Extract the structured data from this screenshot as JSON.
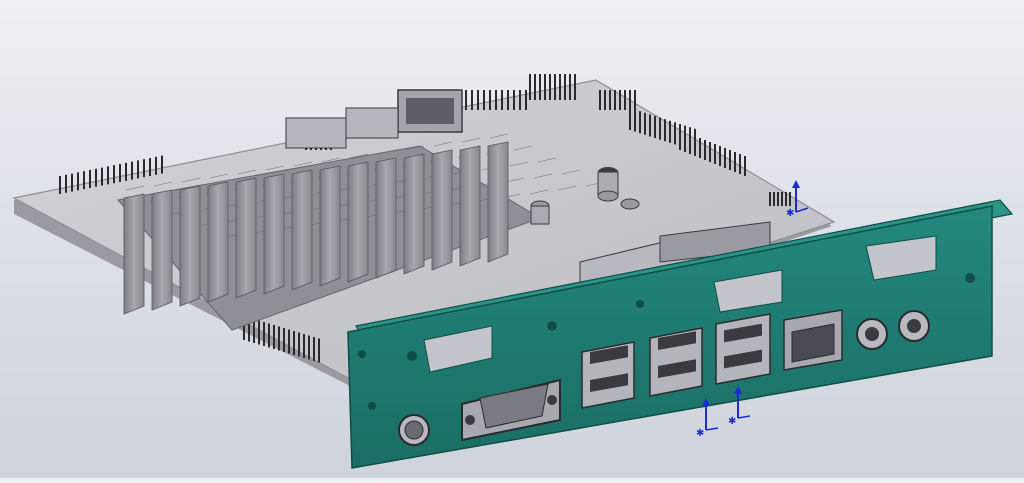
{
  "viewport": {
    "background_top": "#eef0f4",
    "background_bottom": "#cfd4dc"
  },
  "model": {
    "board_color": "#c9c9cf",
    "board_edge_color": "#8e8e96",
    "heatsink_color": "#9c9ca4",
    "bracket_color": "#1f7c72",
    "bracket_edge_color": "#0f4e47",
    "connector_color": "#b0b0b8",
    "pin_color": "#2a2a2e",
    "triad_color": "#1a2bd8",
    "io_ports": [
      {
        "name": "ps2-port"
      },
      {
        "name": "vga-port"
      },
      {
        "name": "usb-port-pair-1"
      },
      {
        "name": "usb-port-pair-2"
      },
      {
        "name": "usb-port-pair-3"
      },
      {
        "name": "ethernet-port"
      },
      {
        "name": "audio-jack-1"
      },
      {
        "name": "audio-jack-2"
      }
    ]
  }
}
